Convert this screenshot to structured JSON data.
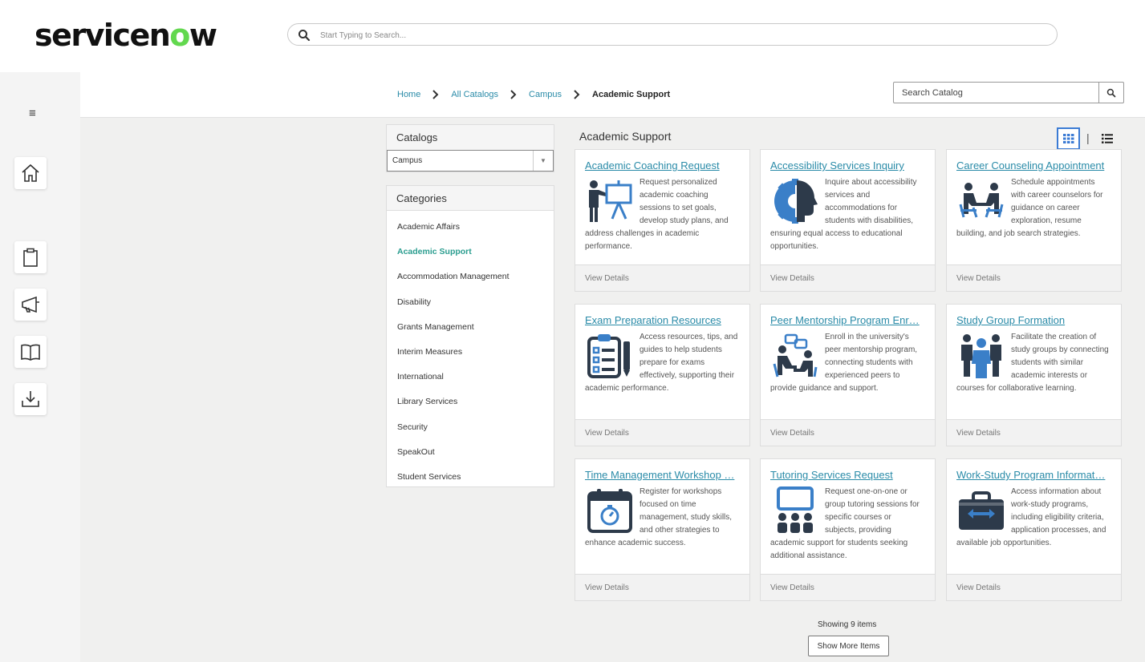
{
  "header": {
    "logo_text": "servicenow",
    "search_placeholder": "Start Typing to Search..."
  },
  "rail": {
    "items": [
      {
        "icon": "home-icon"
      },
      {
        "icon": "clipboard-icon"
      },
      {
        "icon": "megaphone-icon"
      },
      {
        "icon": "book-icon"
      },
      {
        "icon": "download-icon"
      }
    ]
  },
  "breadcrumb": {
    "items": [
      "Home",
      "All Catalogs",
      "Campus"
    ],
    "current": "Academic Support"
  },
  "catalog_search": {
    "placeholder": "Search Catalog"
  },
  "catalogs_panel": {
    "title": "Catalogs",
    "selected": "Campus"
  },
  "categories_panel": {
    "title": "Categories",
    "items": [
      "Academic Affairs",
      "Academic Support",
      "Accommodation Management",
      "Disability",
      "Grants Management",
      "Interim Measures",
      "International",
      "Library Services",
      "Security",
      "SpeakOut",
      "Student Services"
    ],
    "active": "Academic Support"
  },
  "main": {
    "title": "Academic Support",
    "cards": [
      {
        "title": "Academic Coaching Request",
        "icon": "presenter-icon",
        "description": "Request personalized academic coaching sessions to set goals, develop study plans, and address challenges in academic performance.",
        "link": "View Details"
      },
      {
        "title": "Accessibility Services Inquiry",
        "icon": "head-gear-icon",
        "description": "Inquire about accessibility services and accommodations for students with disabilities, ensuring equal access to educational opportunities.",
        "link": "View Details"
      },
      {
        "title": "Career Counseling Appointment",
        "icon": "counseling-icon",
        "description": "Schedule appointments with career counselors for guidance on career exploration, resume building, and job search strategies.",
        "link": "View Details"
      },
      {
        "title": "Exam Preparation Resources",
        "icon": "checklist-icon",
        "description": "Access resources, tips, and guides to help students prepare for exams effectively, supporting their academic performance.",
        "link": "View Details"
      },
      {
        "title": "Peer Mentorship Program Enr…",
        "icon": "mentorship-icon",
        "description": "Enroll in the university's peer mentorship program, connecting students with experienced peers to provide guidance and support.",
        "link": "View Details"
      },
      {
        "title": "Study Group Formation",
        "icon": "group-icon",
        "description": "Facilitate the creation of study groups by connecting students with similar academic interests or courses for collaborative learning.",
        "link": "View Details"
      },
      {
        "title": "Time Management Workshop …",
        "icon": "calendar-timer-icon",
        "description": "Register for workshops focused on time management, study skills, and other strategies to enhance academic success.",
        "link": "View Details"
      },
      {
        "title": "Tutoring Services Request",
        "icon": "classroom-icon",
        "description": "Request one-on-one or group tutoring sessions for specific courses or subjects, providing academic support for students seeking additional assistance.",
        "link": "View Details"
      },
      {
        "title": "Work-Study Program Informat…",
        "icon": "briefcase-icon",
        "description": "Access information about work-study programs, including eligibility criteria, application processes, and available job opportunities.",
        "link": "View Details"
      }
    ],
    "showing": "Showing 9 items",
    "show_more": "Show More Items"
  }
}
